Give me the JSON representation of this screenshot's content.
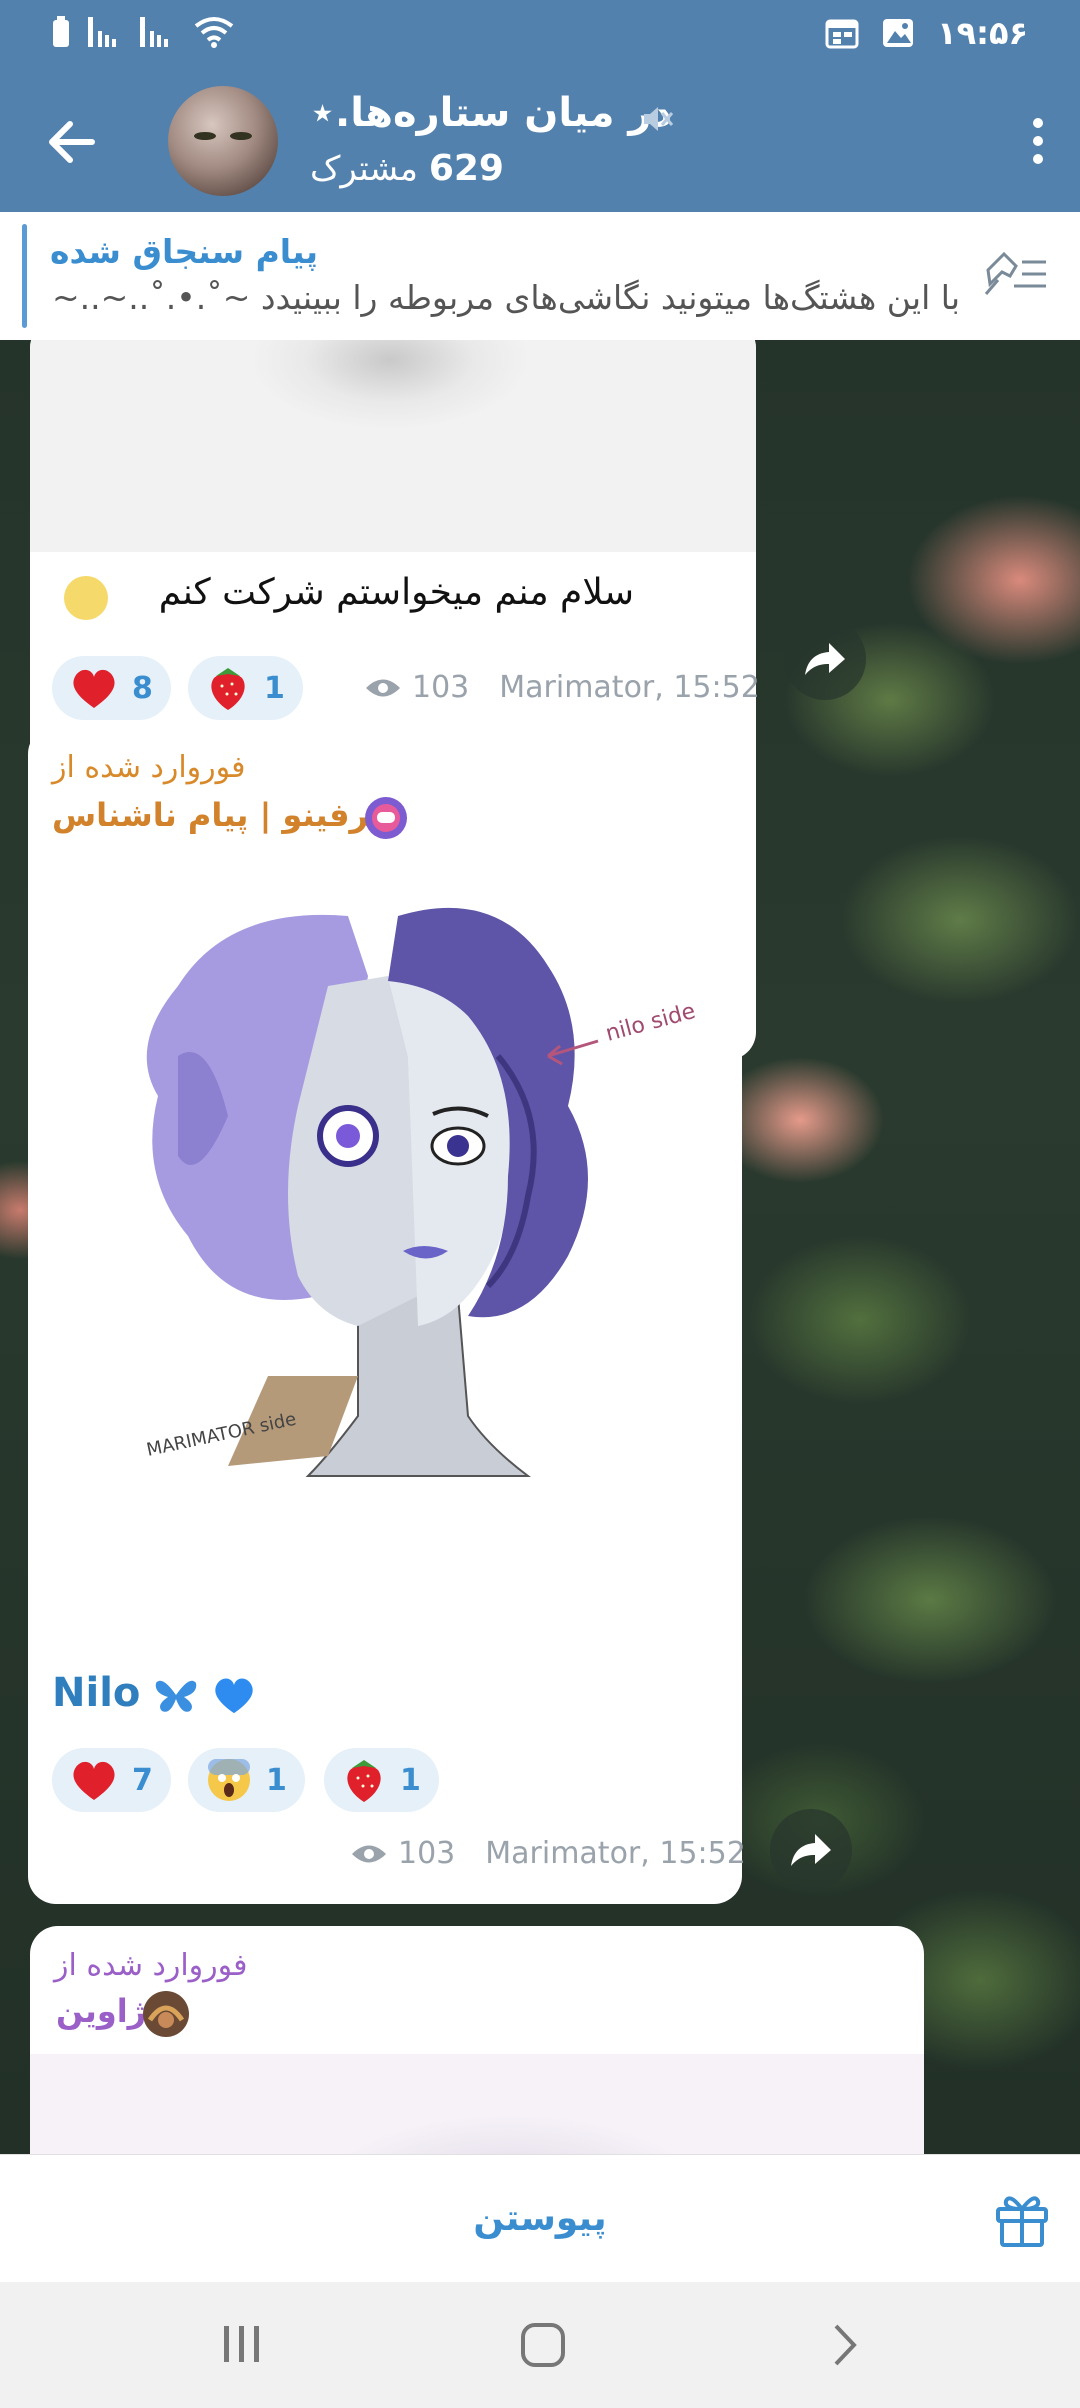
{
  "status_bar": {
    "time": "۱۹:۵۶"
  },
  "header": {
    "title": "در میان ستاره‌ها.⋆",
    "subscribers_count": "629",
    "subscribers_label": "مشترک"
  },
  "pinned": {
    "title": "پیام سنجاق شده",
    "text": "با این هشتگ‌ها میتونید نگاشی‌های مربوطه را ببینیدد ~˚.•.˚..~..~..."
  },
  "messages": [
    {
      "text": "سلام منم میخواستم شرکت کنم",
      "reactions": [
        {
          "emoji": "heart",
          "count": "8"
        },
        {
          "emoji": "strawberry",
          "count": "1"
        }
      ],
      "views": "103",
      "author_time": "Marimator, 15:52"
    },
    {
      "forward_label": "فوروارد شده از",
      "forward_from": "حرفینو | پیام ناشناس",
      "image_labels": {
        "side_note": "nilo side",
        "signature": "MARIMATOR side"
      },
      "caption": "Nilo",
      "reactions": [
        {
          "emoji": "heart",
          "count": "7"
        },
        {
          "emoji": "scream",
          "count": "1"
        },
        {
          "emoji": "strawberry",
          "count": "1"
        }
      ],
      "views": "103",
      "author_time": "Marimator, 15:52"
    },
    {
      "forward_label": "فوروارد شده از",
      "forward_from": "ژاوین"
    }
  ],
  "bottom": {
    "join_label": "پیوستن"
  },
  "colors": {
    "header": "#5381ad",
    "accent": "#3a8ed0",
    "reaction_bg": "#e6f0f9"
  }
}
